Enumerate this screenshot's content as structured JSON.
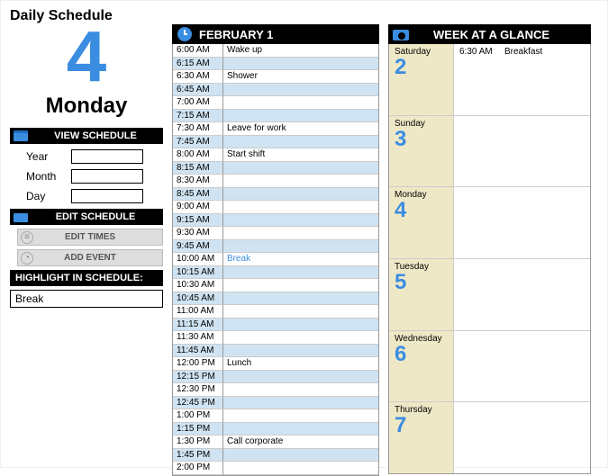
{
  "title": "Daily Schedule",
  "current": {
    "day_num": "4",
    "day_name": "Monday"
  },
  "sections": {
    "view": {
      "title": "VIEW SCHEDULE",
      "fields": {
        "year": "Year",
        "month": "Month",
        "day": "Day"
      }
    },
    "edit": {
      "title": "EDIT SCHEDULE",
      "btn_edit_times": "EDIT TIMES",
      "btn_add_event": "ADD EVENT"
    },
    "highlight": {
      "title": "HIGHLIGHT IN SCHEDULE:",
      "value": "Break"
    }
  },
  "schedule": {
    "header": "FEBRUARY 1",
    "rows": [
      {
        "time": "6:00 AM",
        "event": "Wake up",
        "alt": false
      },
      {
        "time": "6:15 AM",
        "event": "",
        "alt": true
      },
      {
        "time": "6:30 AM",
        "event": "Shower",
        "alt": false
      },
      {
        "time": "6:45 AM",
        "event": "",
        "alt": true
      },
      {
        "time": "7:00 AM",
        "event": "",
        "alt": false
      },
      {
        "time": "7:15 AM",
        "event": "",
        "alt": true
      },
      {
        "time": "7:30 AM",
        "event": "Leave for work",
        "alt": false
      },
      {
        "time": "7:45 AM",
        "event": "",
        "alt": true
      },
      {
        "time": "8:00 AM",
        "event": "Start shift",
        "alt": false
      },
      {
        "time": "8:15 AM",
        "event": "",
        "alt": true
      },
      {
        "time": "8:30 AM",
        "event": "",
        "alt": false
      },
      {
        "time": "8:45 AM",
        "event": "",
        "alt": true
      },
      {
        "time": "9:00 AM",
        "event": "",
        "alt": false
      },
      {
        "time": "9:15 AM",
        "event": "",
        "alt": true
      },
      {
        "time": "9:30 AM",
        "event": "",
        "alt": false
      },
      {
        "time": "9:45 AM",
        "event": "",
        "alt": true
      },
      {
        "time": "10:00 AM",
        "event": "Break",
        "alt": false,
        "highlight": true
      },
      {
        "time": "10:15 AM",
        "event": "",
        "alt": true
      },
      {
        "time": "10:30 AM",
        "event": "",
        "alt": false
      },
      {
        "time": "10:45 AM",
        "event": "",
        "alt": true
      },
      {
        "time": "11:00 AM",
        "event": "",
        "alt": false
      },
      {
        "time": "11:15 AM",
        "event": "",
        "alt": true
      },
      {
        "time": "11:30 AM",
        "event": "",
        "alt": false
      },
      {
        "time": "11:45 AM",
        "event": "",
        "alt": true
      },
      {
        "time": "12:00 PM",
        "event": "Lunch",
        "alt": false
      },
      {
        "time": "12:15 PM",
        "event": "",
        "alt": true
      },
      {
        "time": "12:30 PM",
        "event": "",
        "alt": false
      },
      {
        "time": "12:45 PM",
        "event": "",
        "alt": true
      },
      {
        "time": "1:00 PM",
        "event": "",
        "alt": false
      },
      {
        "time": "1:15 PM",
        "event": "",
        "alt": true
      },
      {
        "time": "1:30 PM",
        "event": "Call corporate",
        "alt": false
      },
      {
        "time": "1:45 PM",
        "event": "",
        "alt": true
      },
      {
        "time": "2:00 PM",
        "event": "",
        "alt": false
      }
    ]
  },
  "week": {
    "header": "WEEK AT A GLANCE",
    "days": [
      {
        "name": "Saturday",
        "num": "2",
        "events": [
          {
            "time": "6:30 AM",
            "label": "Breakfast"
          }
        ]
      },
      {
        "name": "Sunday",
        "num": "3",
        "events": []
      },
      {
        "name": "Monday",
        "num": "4",
        "events": []
      },
      {
        "name": "Tuesday",
        "num": "5",
        "events": []
      },
      {
        "name": "Wednesday",
        "num": "6",
        "events": []
      },
      {
        "name": "Thursday",
        "num": "7",
        "events": []
      }
    ]
  }
}
